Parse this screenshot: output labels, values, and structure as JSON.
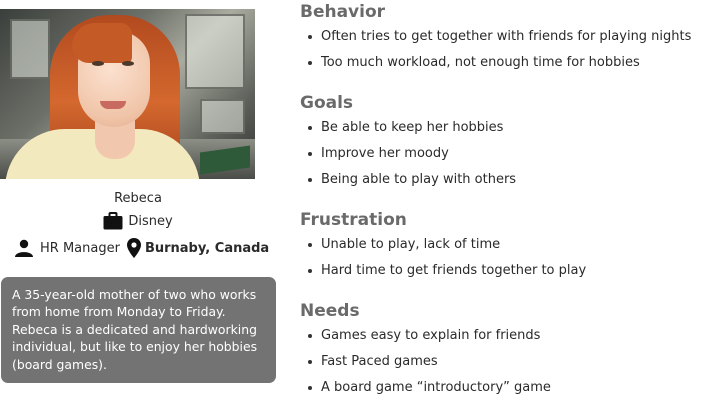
{
  "profile": {
    "name": "Rebeca",
    "company": "Disney",
    "role": "HR Manager",
    "location": "Burnaby, Canada",
    "bio": "A 35-year-old mother of two who works from home from Monday to Friday. Rebeca is a dedicated and hardworking individual, but like to enjoy her hobbies (board games)."
  },
  "sections": [
    {
      "title": "Behavior",
      "items": [
        "Often tries to get together with friends for playing nights",
        "Too much workload, not enough time for hobbies"
      ]
    },
    {
      "title": "Goals",
      "items": [
        "Be able to keep her hobbies",
        "Improve her moody",
        "Being able to play with others"
      ]
    },
    {
      "title": "Frustration",
      "items": [
        "Unable to play, lack of time",
        "Hard time to get friends together to play"
      ]
    },
    {
      "title": "Needs",
      "items": [
        "Games easy to explain for friends",
        "Fast Paced games",
        "A board game “introductory” game"
      ]
    }
  ],
  "icons": {
    "company": "briefcase-icon",
    "role": "person-icon",
    "location": "map-pin-icon"
  },
  "colors": {
    "bio_background": "#737373",
    "section_title": "#6a6a6a",
    "text": "#2a2a2a"
  }
}
